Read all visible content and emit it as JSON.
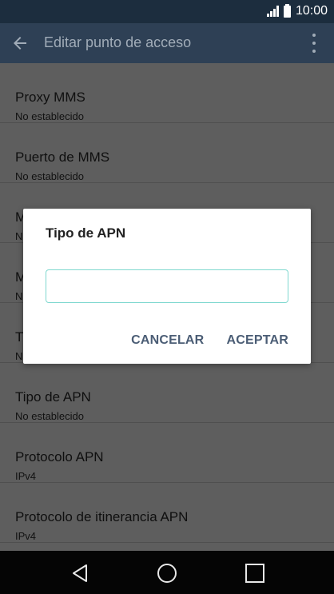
{
  "status_bar": {
    "time": "10:00"
  },
  "app_bar": {
    "title": "Editar punto de acceso",
    "back_icon": "arrow-left-icon",
    "menu_icon": "more-vert-icon"
  },
  "settings": [
    {
      "title": "Proxy MMS",
      "value": "No establecido"
    },
    {
      "title": "Puerto de MMS",
      "value": "No establecido"
    },
    {
      "title": "M",
      "value": "N"
    },
    {
      "title": "M",
      "value": "N"
    },
    {
      "title": "T",
      "value": "N"
    },
    {
      "title": "Tipo de APN",
      "value": "No establecido"
    },
    {
      "title": "Protocolo APN",
      "value": "IPv4"
    },
    {
      "title": "Protocolo de itinerancia APN",
      "value": "IPv4"
    }
  ],
  "dialog": {
    "title": "Tipo de APN",
    "input_value": "",
    "cancel_label": "CANCELAR",
    "accept_label": "ACEPTAR"
  },
  "nav_bar": {
    "back_icon": "nav-back-icon",
    "home_icon": "nav-home-icon",
    "recents_icon": "nav-recents-icon"
  },
  "colors": {
    "accent": "#7fd8cf",
    "button_text": "#4b5d75",
    "app_bar": "#2e4055",
    "status_bar": "#1c2d3e"
  }
}
